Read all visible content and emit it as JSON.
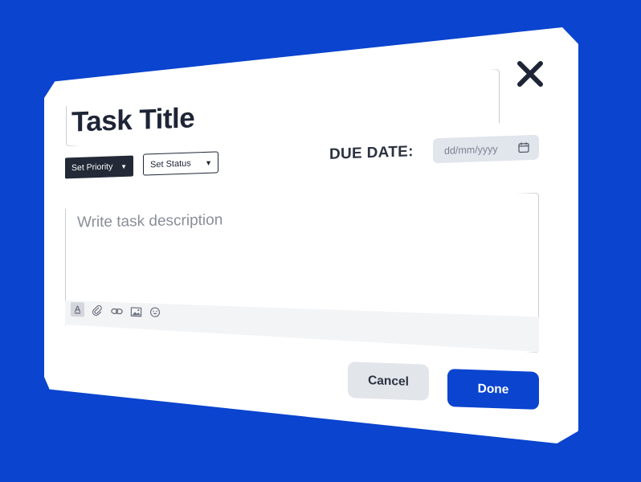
{
  "dialog": {
    "title_value": "Task Title",
    "priority_label": "Set Priority",
    "status_label": "Set Status",
    "due_date_label": "DUE DATE:",
    "due_date_placeholder": "dd/mm/yyyy",
    "description_placeholder": "Write task description",
    "cancel_label": "Cancel",
    "done_label": "Done"
  },
  "icons": {
    "close": "close-icon",
    "calendar": "calendar-icon",
    "toolbar": [
      "text-format-icon",
      "attachment-icon",
      "link-icon",
      "image-icon",
      "emoji-icon"
    ]
  },
  "colors": {
    "background": "#0a44cf",
    "primary": "#0a44cf",
    "dark": "#232937"
  }
}
